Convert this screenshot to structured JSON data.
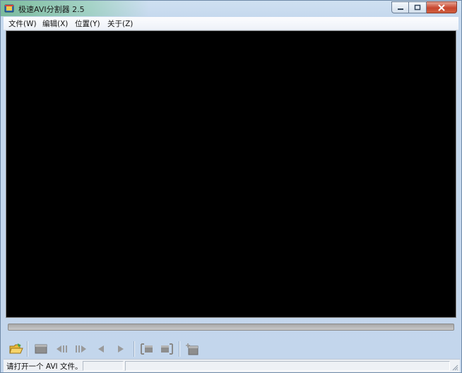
{
  "window": {
    "title": "极速AVI分割器 2.5",
    "accent_glow": "#3fa05f",
    "close_color": "#c7462f"
  },
  "menubar": {
    "items": [
      {
        "label": "文件(W)"
      },
      {
        "label": "编辑(X)"
      },
      {
        "label": "位置(Y)"
      },
      {
        "label": "关于(Z)"
      }
    ]
  },
  "video": {
    "background": "#000000"
  },
  "seekbar": {
    "progress": 0
  },
  "toolbar": {
    "buttons": [
      {
        "icon": "open-folder-icon",
        "enabled": true
      },
      {
        "icon": "stop-icon",
        "enabled": false
      },
      {
        "icon": "previous-frame-icon",
        "enabled": false
      },
      {
        "icon": "next-frame-icon",
        "enabled": false
      },
      {
        "icon": "step-back-icon",
        "enabled": false
      },
      {
        "icon": "play-icon",
        "enabled": false
      },
      {
        "icon": "mark-in-icon",
        "enabled": false
      },
      {
        "icon": "mark-out-icon",
        "enabled": false
      },
      {
        "icon": "split-save-icon",
        "enabled": false
      }
    ]
  },
  "statusbar": {
    "message": "请打开一个 AVI 文件。"
  }
}
